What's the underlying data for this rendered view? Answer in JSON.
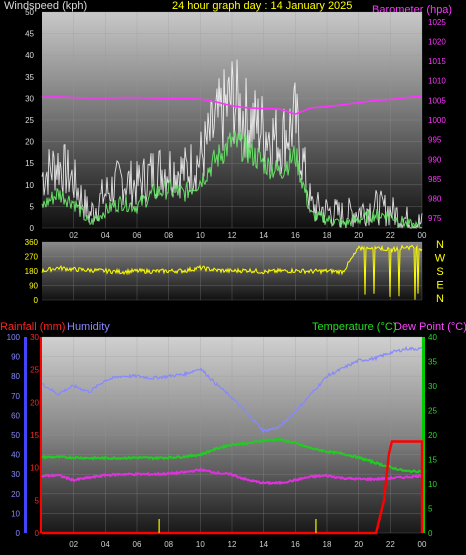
{
  "header": {
    "windspeed_label": "Windspeed (kph)",
    "title": "24 hour graph day : 14 January 2025",
    "barometer_label": "Barometer (hpa)"
  },
  "bottom_header": {
    "rainfall_label": "Rainfall (mm)",
    "humidity_label": "Humidity",
    "temperature_label": "Temperature (°C)",
    "dewpoint_label": "Dew Point (°C)"
  },
  "colors": {
    "windspeed": "#ffffff",
    "windspeed_avg": "#66dd66",
    "barometer": "#ff33ff",
    "direction": "#ffff00",
    "temperature": "#22cc22",
    "dewpoint": "#dd33dd",
    "humidity": "#8888ff",
    "rainfall": "#ff0000",
    "rain_rate": "#cccc00",
    "axis_left": "#4444ff",
    "axis_rain": "#ff0000",
    "axis_right": "#00cc00"
  },
  "direction_labels": [
    "N",
    "W",
    "S",
    "E",
    "N"
  ],
  "chart_data": [
    {
      "type": "line",
      "name": "wind-and-barometer",
      "x_ticks": [
        "02",
        "04",
        "06",
        "08",
        "10",
        "12",
        "14",
        "16",
        "18",
        "20",
        "22",
        "00"
      ],
      "y_left_ticks": [
        "0",
        "5",
        "10",
        "15",
        "20",
        "25",
        "30",
        "35",
        "40",
        "45",
        "50"
      ],
      "y_left_range": [
        0,
        50
      ],
      "y_right_ticks": [
        "975",
        "980",
        "985",
        "990",
        "995",
        "1000",
        "1005",
        "1010",
        "1015",
        "1020",
        "1025"
      ],
      "y_right_range": [
        972.5,
        1027.5
      ],
      "hours": [
        0,
        1,
        2,
        3,
        4,
        5,
        6,
        7,
        8,
        9,
        10,
        11,
        12,
        13,
        14,
        15,
        16,
        17,
        18,
        19,
        20,
        21,
        22,
        23,
        24
      ],
      "series": [
        {
          "name": "Windspeed (kph)",
          "values": [
            12,
            15,
            11,
            3,
            8,
            11,
            10,
            13,
            14,
            13,
            16,
            24,
            30,
            25,
            23,
            20,
            25,
            5,
            4,
            3,
            4,
            5,
            4,
            2,
            1
          ]
        },
        {
          "name": "Windspeed (kph)",
          "values": [
            5,
            8,
            6,
            1,
            4,
            6,
            5,
            8,
            9,
            8,
            11,
            16,
            20,
            18,
            15,
            13,
            17,
            3,
            2,
            1,
            2,
            3,
            3,
            1,
            0
          ]
        },
        {
          "name": "Barometer (hpa)",
          "values": [
            1005.8,
            1005.9,
            1005.7,
            1005.6,
            1005.6,
            1005.7,
            1005.7,
            1005.6,
            1005.5,
            1005.5,
            1005.3,
            1004.6,
            1003.6,
            1003.1,
            1002.9,
            1002.8,
            1001.5,
            1003.1,
            1003.4,
            1003.9,
            1004.4,
            1005.0,
            1005.2,
            1005.7,
            1006.1
          ]
        }
      ]
    },
    {
      "type": "scatter",
      "name": "wind-direction",
      "y_ticks": [
        "0",
        "90",
        "180",
        "270",
        "360"
      ],
      "y_range": [
        0,
        360
      ],
      "hours": [
        0,
        1,
        2,
        3,
        4,
        5,
        6,
        7,
        8,
        9,
        10,
        11,
        12,
        13,
        14,
        15,
        16,
        17,
        18,
        19,
        20,
        21,
        22,
        23,
        24
      ],
      "values": [
        180,
        200,
        190,
        185,
        180,
        175,
        180,
        178,
        180,
        182,
        200,
        185,
        180,
        185,
        175,
        180,
        182,
        178,
        180,
        175,
        320,
        330,
        310,
        330,
        320
      ]
    },
    {
      "type": "line",
      "name": "temperature-humidity-rain",
      "x_ticks": [
        "02",
        "04",
        "06",
        "08",
        "10",
        "12",
        "14",
        "16",
        "18",
        "20",
        "22",
        "00"
      ],
      "y_humidity_ticks": [
        "0",
        "10",
        "20",
        "30",
        "40",
        "50",
        "60",
        "70",
        "80",
        "90",
        "100"
      ],
      "y_humidity_range": [
        0,
        100
      ],
      "y_rain_ticks": [
        "0",
        "5",
        "10",
        "15",
        "20",
        "25",
        "30"
      ],
      "y_rain_range": [
        0,
        30
      ],
      "y_temp_ticks": [
        "0",
        "5",
        "10",
        "15",
        "20",
        "25",
        "30",
        "35",
        "40"
      ],
      "y_temp_range": [
        0,
        40
      ],
      "hours": [
        0,
        1,
        2,
        3,
        4,
        5,
        6,
        7,
        8,
        9,
        10,
        11,
        12,
        13,
        14,
        15,
        16,
        17,
        18,
        19,
        20,
        21,
        22,
        23,
        24
      ],
      "series": [
        {
          "name": "Humidity",
          "values": [
            76,
            71,
            75,
            72,
            78,
            80,
            80,
            79,
            80,
            81,
            84,
            76,
            69,
            61,
            52,
            54,
            62,
            71,
            80,
            84,
            88,
            89,
            92,
            94,
            94
          ]
        },
        {
          "name": "Temperature (°C)",
          "values": [
            15.5,
            15.5,
            15.4,
            15.3,
            15.3,
            15.3,
            15.4,
            15.3,
            15.4,
            15.6,
            16.0,
            17.2,
            18.1,
            18.3,
            18.9,
            19.1,
            18.3,
            17.3,
            16.6,
            16.2,
            15.4,
            14.4,
            13.4,
            12.6,
            12.6
          ]
        },
        {
          "name": "Dew Point (°C)",
          "values": [
            11.6,
            11.8,
            10.8,
            11.3,
            11.8,
            12.0,
            12.0,
            12.0,
            12.1,
            12.4,
            12.9,
            12.3,
            11.9,
            10.8,
            10.2,
            10.2,
            10.8,
            11.5,
            11.7,
            11.2,
            11.0,
            11.0,
            11.2,
            11.4,
            11.7
          ]
        },
        {
          "name": "Rainfall (mm)",
          "values": [
            0,
            0,
            0,
            0,
            0,
            0,
            0,
            0,
            0,
            0,
            0,
            0,
            0,
            0,
            0,
            0,
            0,
            0,
            0,
            0,
            0,
            0,
            14,
            14,
            14
          ]
        }
      ],
      "rain_rate_marks": [
        7.4,
        17.3
      ]
    }
  ]
}
